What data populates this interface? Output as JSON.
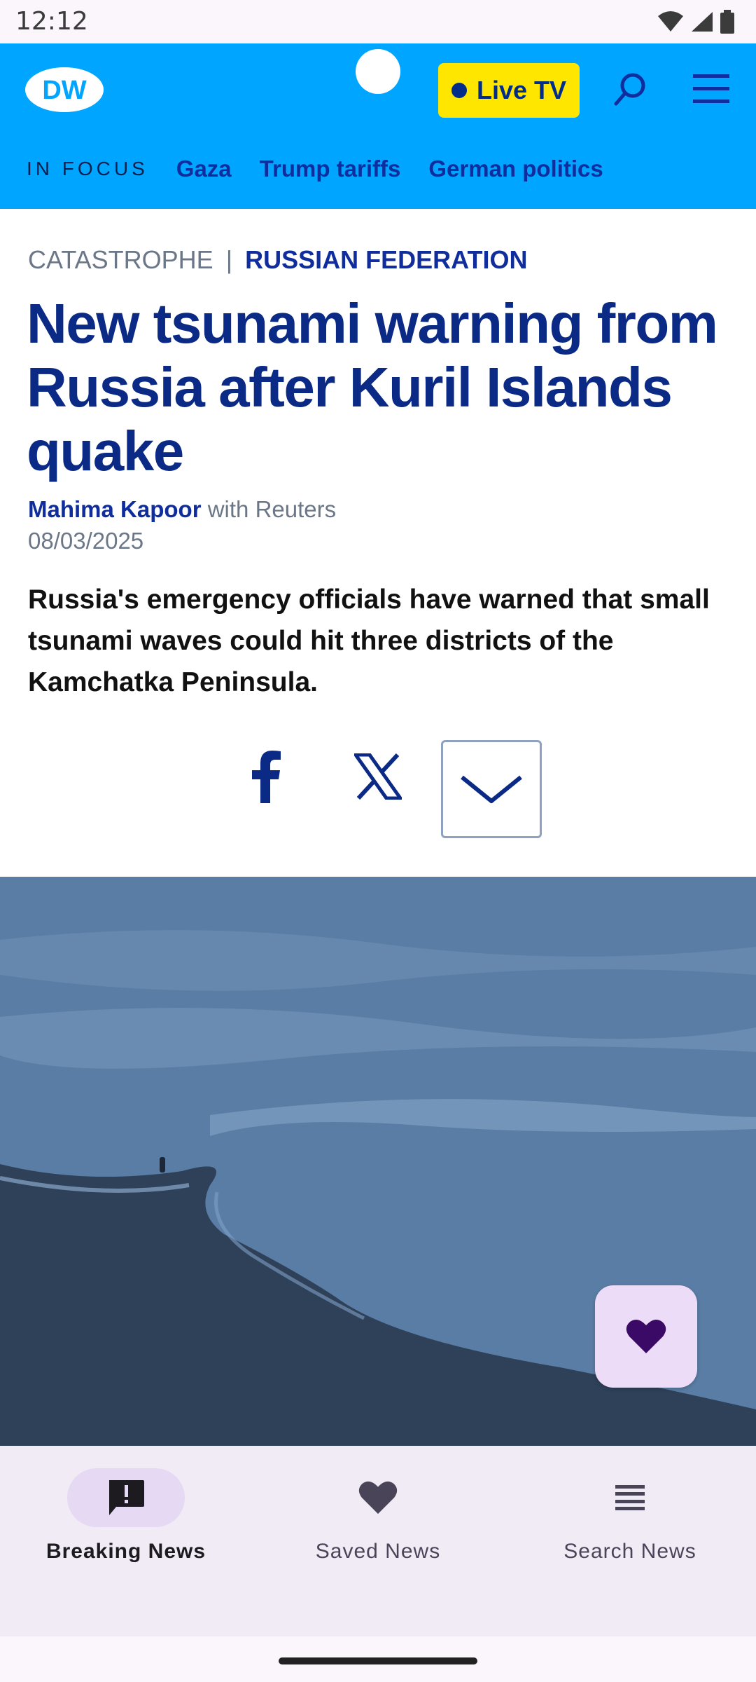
{
  "status_bar": {
    "time": "12:12"
  },
  "header": {
    "logo_text": "DW",
    "live_button_label": "Live TV",
    "in_focus_label": "IN FOCUS",
    "focus_links": [
      "Gaza",
      "Trump tariffs",
      "German politics"
    ]
  },
  "article": {
    "category": "CATASTROPHE",
    "separator": "|",
    "country": "RUSSIAN FEDERATION",
    "headline": "New tsunami warning from Russia after Kuril Islands quake",
    "author": "Mahima Kapoor",
    "author_suffix": "with Reuters",
    "date": "08/03/2025",
    "lead": "Russia's emergency officials have warned that small tsunami waves could hit three districts of the Kamchatka Peninsula."
  },
  "share": {
    "icons": [
      "facebook-icon",
      "x-icon",
      "chevron-down-icon"
    ]
  },
  "bottom_nav": {
    "items": [
      {
        "label": "Breaking News",
        "icon": "alert-message-icon",
        "active": true
      },
      {
        "label": "Saved News",
        "icon": "heart-icon",
        "active": false
      },
      {
        "label": "Search News",
        "icon": "list-icon",
        "active": false
      }
    ]
  },
  "colors": {
    "header_bg": "#00a5ff",
    "live_button_bg": "#ffe600",
    "headline": "#0a2a86",
    "accent_link": "#0f2d9c",
    "nav_active_pill": "#e5d9f4",
    "fav_button_bg": "#eddcf7",
    "fav_heart": "#3b0a66"
  }
}
